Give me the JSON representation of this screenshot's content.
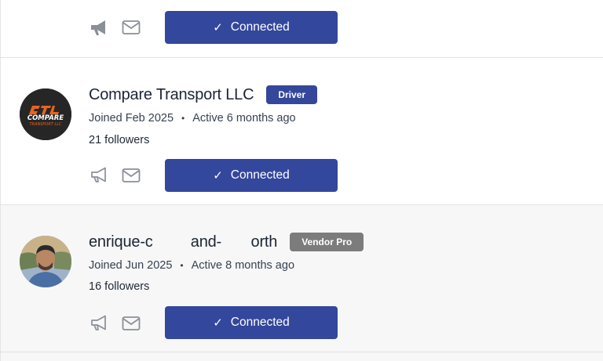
{
  "cards": [
    {
      "button_label": "Connected"
    },
    {
      "name": "Compare Transport LLC",
      "badge": "Driver",
      "joined": "Joined Feb 2025",
      "active": "Active 6 months ago",
      "followers_count": "21",
      "followers_label": "followers",
      "button_label": "Connected",
      "logo_text_top": "COMPARE",
      "logo_text_bottom": "TRANSPORT LLC"
    },
    {
      "name": "enrique-c         and-       orth",
      "badge": "Vendor Pro",
      "joined": "Joined Jun 2025",
      "active": "Active 8 months ago",
      "followers_count": "16",
      "followers_label": "followers",
      "button_label": "Connected"
    }
  ],
  "separator": "•",
  "check_glyph": "✓",
  "icons": {
    "announce": "megaphone-icon",
    "message": "mail-icon"
  },
  "colors": {
    "primary": "#33479c",
    "badge_driver": "#34479a",
    "badge_vendor": "#7c7c7c",
    "logo_accent": "#e8631c"
  }
}
